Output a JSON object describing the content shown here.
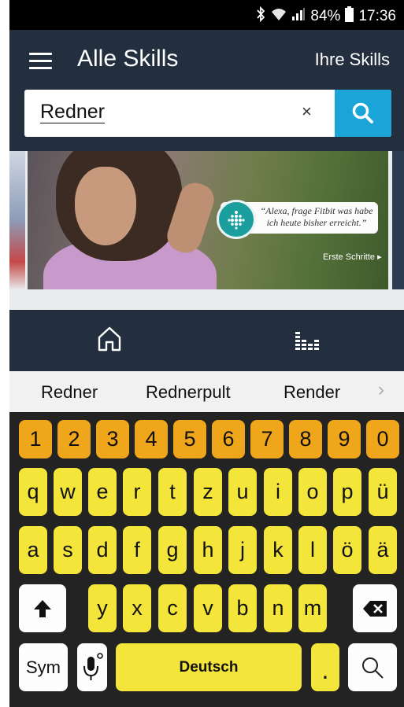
{
  "status_bar": {
    "battery": "84%",
    "time": "17:36"
  },
  "header": {
    "title": "Alle Skills",
    "your_skills": "Ihre Skills"
  },
  "search": {
    "value": "Redner",
    "clear": "×"
  },
  "banner": {
    "quote_line1": "“Alexa, frage Fitbit was habe",
    "quote_line2": "ich heute bisher erreicht.”",
    "cta": "Erste Schritte ▸"
  },
  "suggestions": [
    "Redner",
    "Rednerpult",
    "Render"
  ],
  "suggestion_more": "›",
  "keyboard": {
    "numbers": [
      "1",
      "2",
      "3",
      "4",
      "5",
      "6",
      "7",
      "8",
      "9",
      "0"
    ],
    "row1": [
      "q",
      "w",
      "e",
      "r",
      "t",
      "z",
      "u",
      "i",
      "o",
      "p",
      "ü"
    ],
    "row2": [
      "a",
      "s",
      "d",
      "f",
      "g",
      "h",
      "j",
      "k",
      "l",
      "ö",
      "ä"
    ],
    "row3": [
      "y",
      "x",
      "c",
      "v",
      "b",
      "n",
      "m"
    ],
    "sym": "Sym",
    "space": "Deutsch",
    "period": "."
  },
  "colors": {
    "header_bg": "#232f3e",
    "search_button": "#1ba4d8",
    "key_yellow": "#f4e53a",
    "key_orange": "#f0a61b",
    "keyboard_bg": "#232323"
  }
}
